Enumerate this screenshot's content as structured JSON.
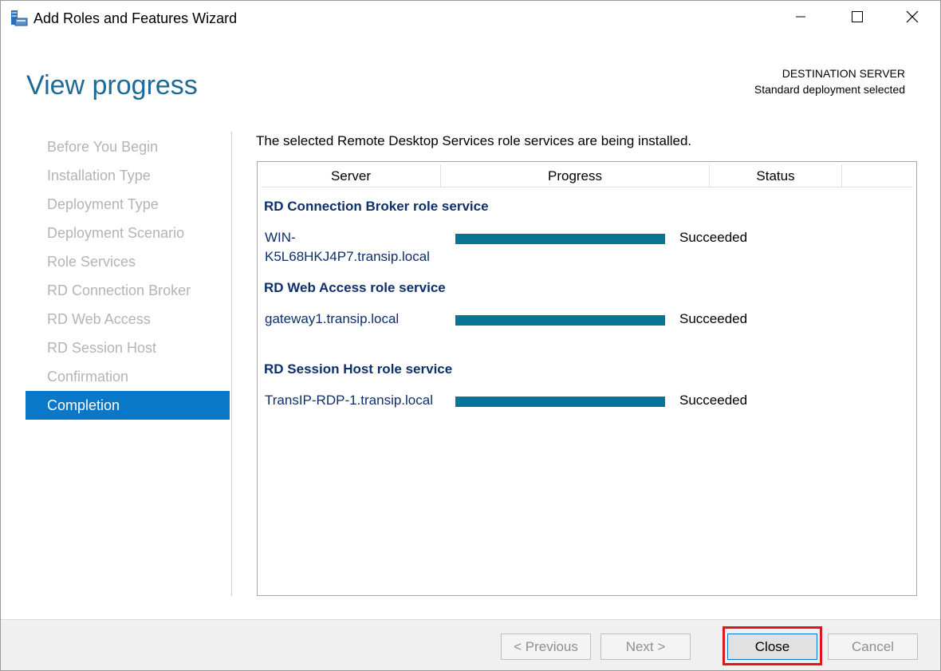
{
  "window": {
    "title": "Add Roles and Features Wizard",
    "icon": "server-manager-icon",
    "controls": [
      "minimize-icon",
      "maximize-icon",
      "close-icon"
    ]
  },
  "header": {
    "page_title": "View progress",
    "destination_label": "DESTINATION SERVER",
    "destination_value": "Standard deployment selected"
  },
  "nav": {
    "items": [
      {
        "label": "Before You Begin"
      },
      {
        "label": "Installation Type"
      },
      {
        "label": "Deployment Type"
      },
      {
        "label": "Deployment Scenario"
      },
      {
        "label": "Role Services"
      },
      {
        "label": "RD Connection Broker"
      },
      {
        "label": "RD Web Access"
      },
      {
        "label": "RD Session Host"
      },
      {
        "label": "Confirmation"
      },
      {
        "label": "Completion"
      }
    ],
    "active": "Completion"
  },
  "main": {
    "intro": "The selected Remote Desktop Services role services are being installed.",
    "columns": {
      "server": "Server",
      "progress": "Progress",
      "status": "Status"
    },
    "groups": [
      {
        "title": "RD Connection Broker role service",
        "server_line1": "WIN-",
        "server_line2": "K5L68HKJ4P7.transip.local",
        "progress": 1.0,
        "status": "Succeeded"
      },
      {
        "title": "RD Web Access role service",
        "server_line1": "gateway1.transip.local",
        "server_line2": "",
        "progress": 1.0,
        "status": "Succeeded"
      },
      {
        "title": "RD Session Host role service",
        "server_line1": "TransIP-RDP-1.transip.local",
        "server_line2": "",
        "progress": 1.0,
        "status": "Succeeded"
      }
    ]
  },
  "footer": {
    "previous_label": "< Previous",
    "next_label": "Next >",
    "close_label": "Close",
    "cancel_label": "Cancel"
  },
  "colors": {
    "accent": "#0a78c8",
    "title": "#1e6a97",
    "progress_fill": "#0a7497",
    "highlight": "#e0151f"
  }
}
